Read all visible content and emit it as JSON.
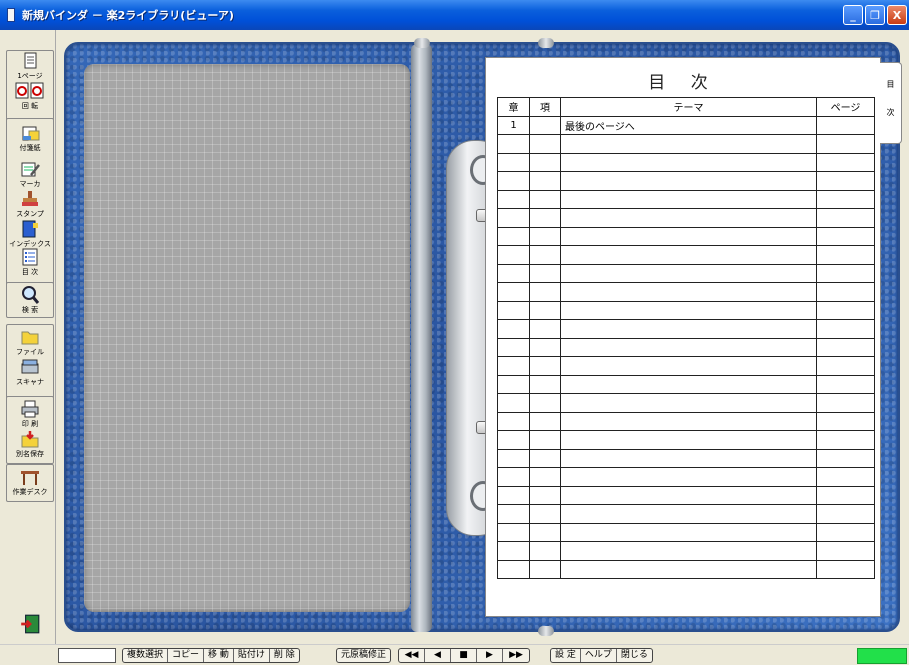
{
  "window": {
    "title": "新規バインダ － 楽2ライブラリ(ビューア)",
    "buttons": {
      "minimize": "_",
      "restore": "❐",
      "close": "X"
    }
  },
  "toolbar": {
    "page": "1ページ",
    "rotate": "回 転",
    "sticky": "付箋紙",
    "marker": "マーカ",
    "stamp": "スタンプ",
    "index": "インデックス",
    "toc": "目 次",
    "search": "検 索",
    "file": "ファイル",
    "scanner": "スキャナ",
    "print": "印 刷",
    "save_as": "別名保存",
    "desk": "作業デスク"
  },
  "toc_page": {
    "title": "目 次",
    "tab_labels": [
      "目",
      "次"
    ],
    "headers": {
      "chapter": "章",
      "item": "項",
      "theme": "テーマ",
      "page": "ページ"
    },
    "rows": [
      {
        "chapter": "1",
        "item": "",
        "theme": "最後のページへ",
        "page": ""
      }
    ],
    "empty_rows": 24
  },
  "bottombar": {
    "group1": [
      "複数選択",
      "コピー",
      "移 動",
      "貼付け",
      "削 除"
    ],
    "group2": [
      "元原稿修正"
    ],
    "group3": [
      "◀◀",
      "◀",
      "■",
      "▶",
      "▶▶"
    ],
    "group4": [
      "設 定",
      "ヘルプ",
      "閉じる"
    ]
  },
  "colors": {
    "titlebar": "#0050d8",
    "binder": "#2f5fa8",
    "status_green": "#22e04a"
  }
}
